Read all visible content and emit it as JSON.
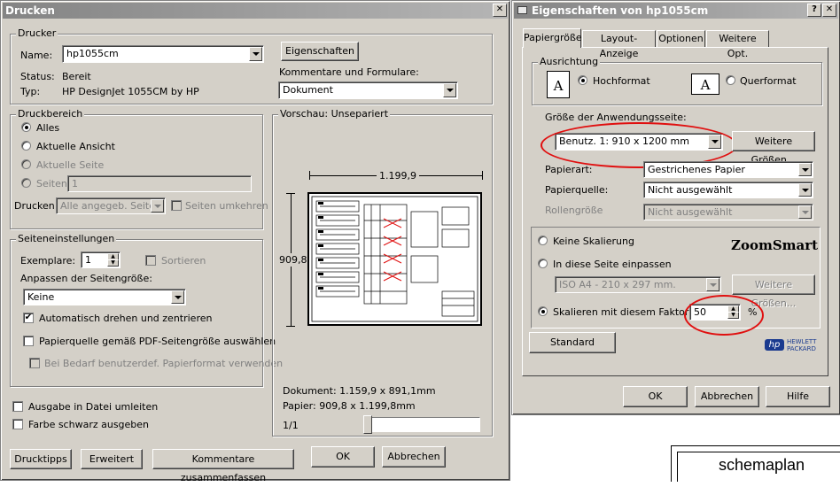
{
  "print_dialog": {
    "title": "Drucken",
    "printer": {
      "group_label": "Drucker",
      "name_label": "Name:",
      "name_value": "hp1055cm",
      "status_label": "Status:",
      "status_value": "Bereit",
      "type_label": "Typ:",
      "type_value": "HP DesignJet 1055CM by HP",
      "properties_button": "Eigenschaften",
      "comments_label": "Kommentare und Formulare:",
      "comments_value": "Dokument"
    },
    "print_range": {
      "group_label": "Druckbereich",
      "all": "Alles",
      "current_view": "Aktuelle Ansicht",
      "current_page": "Aktuelle Seite",
      "pages": "Seiten",
      "pages_value": "1",
      "print_label": "Drucken:",
      "print_value": "Alle angegeb. Seiten",
      "reverse_pages": "Seiten umkehren"
    },
    "page_setup": {
      "group_label": "Seiteneinstellungen",
      "copies_label": "Exemplare:",
      "copies_value": "1",
      "collate": "Sortieren",
      "fit_label": "Anpassen der Seitengröße:",
      "fit_value": "Keine",
      "auto_rotate": "Automatisch drehen und zentrieren",
      "paper_source": "Papierquelle gemäß PDF-Seitengröße auswählen",
      "custom_paper": "Bei Bedarf benutzerdef. Papierformat verwenden"
    },
    "print_to_file": "Ausgabe in Datei umleiten",
    "print_bw": "Farbe schwarz ausgeben",
    "preview": {
      "group_label": "Vorschau: Unsepariert",
      "width_dim": "1.199,9",
      "height_dim": "909,83",
      "document_info": "Dokument: 1.159,9 x 891,1mm",
      "paper_info": "Papier: 909,8 x 1.199,8mm",
      "page_counter": "1/1"
    },
    "buttons": {
      "print_tips": "Drucktipps",
      "advanced": "Erweitert",
      "summarize_comments": "Kommentare zusammenfassen",
      "ok": "OK",
      "cancel": "Abbrechen"
    }
  },
  "properties_dialog": {
    "title": "Eigenschaften von hp1055cm",
    "tabs": [
      "Papiergröße",
      "Layout-Anzeige",
      "Optionen",
      "Weitere Opt."
    ],
    "orientation": {
      "group_label": "Ausrichtung",
      "portrait": "Hochformat",
      "landscape": "Querformat",
      "icon_letter": "A"
    },
    "app_page_size_label": "Größe der Anwendungsseite:",
    "app_page_size_value": "Benutz. 1: 910 x 1200 mm",
    "more_sizes": "Weitere Größen...",
    "paper_type_label": "Papierart:",
    "paper_type_value": "Gestrichenes Papier",
    "paper_source_label": "Papierquelle:",
    "paper_source_value": "Nicht ausgewählt",
    "roll_size_label": "Rollengröße",
    "roll_size_value": "Nicht ausgewählt",
    "scaling": {
      "none": "Keine Skalierung",
      "fit": "In diese Seite einpassen",
      "fit_value": "ISO A4 - 210 x 297 mm.",
      "more_sizes": "Weitere Größen...",
      "factor": "Skalieren mit diesem Faktor",
      "factor_value": "50",
      "percent": "%",
      "zoomsmart": "ZoomSmart"
    },
    "standard_button": "Standard",
    "hp_logo_text": "hp",
    "hp_brand_line1": "HEWLETT",
    "hp_brand_line2": "PACKARD",
    "buttons": {
      "ok": "OK",
      "cancel": "Abbrechen",
      "help": "Hilfe"
    }
  },
  "background_doc": {
    "text": "schemaplan"
  },
  "colors": {
    "dialog_face": "#d4d0c8",
    "annotation_red": "#e01010",
    "hp_blue": "#1a3a8f"
  }
}
